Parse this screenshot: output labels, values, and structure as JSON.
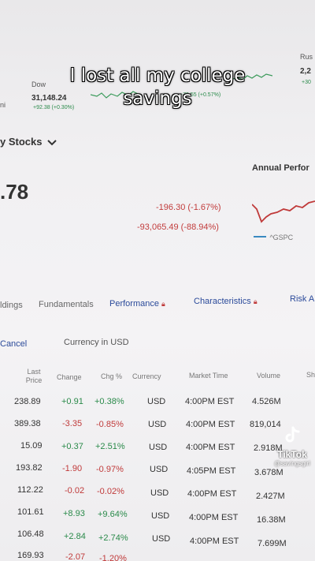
{
  "caption": {
    "line1": "I lost all my college",
    "line2": "savings"
  },
  "ticker": {
    "dow_label": "Dow",
    "dow_value": "31,148.24",
    "dow_change": "+92.38 (+0.30%)",
    "mid_change": "+79.55 (+0.57%)",
    "right_label": "Rus",
    "right_value": "2,2",
    "right_change": "+30"
  },
  "portfolio": {
    "title": "y Stocks",
    "value": ".78",
    "change_day": "-196.30 (-1.67%)",
    "change_total": "-93,065.49 (-88.94%)"
  },
  "annual": {
    "title": "Annual Perfor",
    "legend": "^GSPC"
  },
  "tabs": [
    {
      "label": "ldings"
    },
    {
      "label": "Fundamentals"
    },
    {
      "label": "Performance"
    },
    {
      "label": "Characteristics"
    },
    {
      "label": "Risk A"
    }
  ],
  "toolbar": {
    "cancel": "Cancel",
    "currency": "Currency in USD"
  },
  "table": {
    "headers": [
      "Last Price",
      "Change",
      "Chg %",
      "Currency",
      "Market Time",
      "Volume",
      "Sh"
    ],
    "rows": [
      {
        "price": "238.89",
        "change": "+0.91",
        "pct": "+0.38%",
        "currency": "USD",
        "time": "4:00PM EST",
        "volume": "4.526M",
        "dir": "pos"
      },
      {
        "price": "389.38",
        "change": "-3.35",
        "pct": "-0.85%",
        "currency": "USD",
        "time": "4:00PM EST",
        "volume": "819,014",
        "dir": "neg"
      },
      {
        "price": "15.09",
        "change": "+0.37",
        "pct": "+2.51%",
        "currency": "USD",
        "time": "4:00PM EST",
        "volume": "2.918M",
        "dir": "pos"
      },
      {
        "price": "193.82",
        "change": "-1.90",
        "pct": "-0.97%",
        "currency": "USD",
        "time": "4:05PM EST",
        "volume": "3.678M",
        "dir": "neg"
      },
      {
        "price": "112.22",
        "change": "-0.02",
        "pct": "-0.02%",
        "currency": "USD",
        "time": "4:00PM EST",
        "volume": "2.427M",
        "dir": "neg"
      },
      {
        "price": "101.61",
        "change": "+8.93",
        "pct": "+9.64%",
        "currency": "USD",
        "time": "4:00PM EST",
        "volume": "16.38M",
        "dir": "pos"
      },
      {
        "price": "106.48",
        "change": "+2.84",
        "pct": "+2.74%",
        "currency": "USD",
        "time": "4:00PM EST",
        "volume": "7.699M",
        "dir": "pos"
      },
      {
        "price": "169.93",
        "change": "-2.07",
        "pct": "-1.20%",
        "currency": "",
        "time": "",
        "volume": "",
        "dir": "neg"
      }
    ]
  },
  "watermark": {
    "brand": "TikTok",
    "handle": "@savingsgirl"
  },
  "colors": {
    "positive": "#2a8a4a",
    "negative": "#c03a3a",
    "link": "#2b4a9a"
  }
}
